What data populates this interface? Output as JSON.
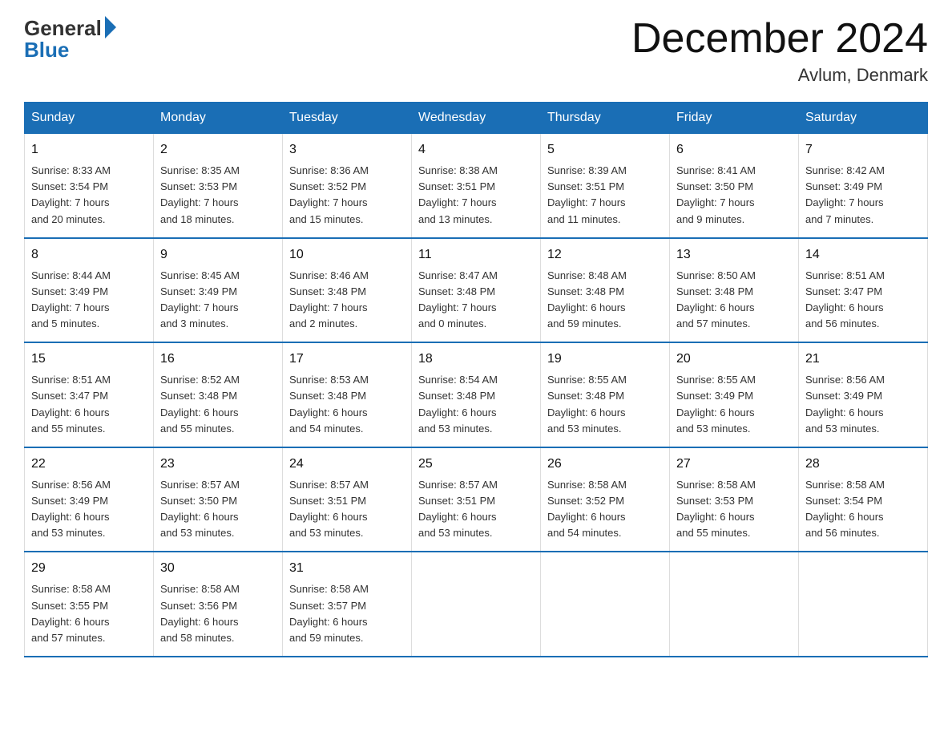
{
  "header": {
    "logo_general": "General",
    "logo_blue": "Blue",
    "month_title": "December 2024",
    "location": "Avlum, Denmark"
  },
  "weekdays": [
    "Sunday",
    "Monday",
    "Tuesday",
    "Wednesday",
    "Thursday",
    "Friday",
    "Saturday"
  ],
  "weeks": [
    [
      {
        "day": "1",
        "sunrise": "Sunrise: 8:33 AM",
        "sunset": "Sunset: 3:54 PM",
        "daylight": "Daylight: 7 hours",
        "daylight2": "and 20 minutes."
      },
      {
        "day": "2",
        "sunrise": "Sunrise: 8:35 AM",
        "sunset": "Sunset: 3:53 PM",
        "daylight": "Daylight: 7 hours",
        "daylight2": "and 18 minutes."
      },
      {
        "day": "3",
        "sunrise": "Sunrise: 8:36 AM",
        "sunset": "Sunset: 3:52 PM",
        "daylight": "Daylight: 7 hours",
        "daylight2": "and 15 minutes."
      },
      {
        "day": "4",
        "sunrise": "Sunrise: 8:38 AM",
        "sunset": "Sunset: 3:51 PM",
        "daylight": "Daylight: 7 hours",
        "daylight2": "and 13 minutes."
      },
      {
        "day": "5",
        "sunrise": "Sunrise: 8:39 AM",
        "sunset": "Sunset: 3:51 PM",
        "daylight": "Daylight: 7 hours",
        "daylight2": "and 11 minutes."
      },
      {
        "day": "6",
        "sunrise": "Sunrise: 8:41 AM",
        "sunset": "Sunset: 3:50 PM",
        "daylight": "Daylight: 7 hours",
        "daylight2": "and 9 minutes."
      },
      {
        "day": "7",
        "sunrise": "Sunrise: 8:42 AM",
        "sunset": "Sunset: 3:49 PM",
        "daylight": "Daylight: 7 hours",
        "daylight2": "and 7 minutes."
      }
    ],
    [
      {
        "day": "8",
        "sunrise": "Sunrise: 8:44 AM",
        "sunset": "Sunset: 3:49 PM",
        "daylight": "Daylight: 7 hours",
        "daylight2": "and 5 minutes."
      },
      {
        "day": "9",
        "sunrise": "Sunrise: 8:45 AM",
        "sunset": "Sunset: 3:49 PM",
        "daylight": "Daylight: 7 hours",
        "daylight2": "and 3 minutes."
      },
      {
        "day": "10",
        "sunrise": "Sunrise: 8:46 AM",
        "sunset": "Sunset: 3:48 PM",
        "daylight": "Daylight: 7 hours",
        "daylight2": "and 2 minutes."
      },
      {
        "day": "11",
        "sunrise": "Sunrise: 8:47 AM",
        "sunset": "Sunset: 3:48 PM",
        "daylight": "Daylight: 7 hours",
        "daylight2": "and 0 minutes."
      },
      {
        "day": "12",
        "sunrise": "Sunrise: 8:48 AM",
        "sunset": "Sunset: 3:48 PM",
        "daylight": "Daylight: 6 hours",
        "daylight2": "and 59 minutes."
      },
      {
        "day": "13",
        "sunrise": "Sunrise: 8:50 AM",
        "sunset": "Sunset: 3:48 PM",
        "daylight": "Daylight: 6 hours",
        "daylight2": "and 57 minutes."
      },
      {
        "day": "14",
        "sunrise": "Sunrise: 8:51 AM",
        "sunset": "Sunset: 3:47 PM",
        "daylight": "Daylight: 6 hours",
        "daylight2": "and 56 minutes."
      }
    ],
    [
      {
        "day": "15",
        "sunrise": "Sunrise: 8:51 AM",
        "sunset": "Sunset: 3:47 PM",
        "daylight": "Daylight: 6 hours",
        "daylight2": "and 55 minutes."
      },
      {
        "day": "16",
        "sunrise": "Sunrise: 8:52 AM",
        "sunset": "Sunset: 3:48 PM",
        "daylight": "Daylight: 6 hours",
        "daylight2": "and 55 minutes."
      },
      {
        "day": "17",
        "sunrise": "Sunrise: 8:53 AM",
        "sunset": "Sunset: 3:48 PM",
        "daylight": "Daylight: 6 hours",
        "daylight2": "and 54 minutes."
      },
      {
        "day": "18",
        "sunrise": "Sunrise: 8:54 AM",
        "sunset": "Sunset: 3:48 PM",
        "daylight": "Daylight: 6 hours",
        "daylight2": "and 53 minutes."
      },
      {
        "day": "19",
        "sunrise": "Sunrise: 8:55 AM",
        "sunset": "Sunset: 3:48 PM",
        "daylight": "Daylight: 6 hours",
        "daylight2": "and 53 minutes."
      },
      {
        "day": "20",
        "sunrise": "Sunrise: 8:55 AM",
        "sunset": "Sunset: 3:49 PM",
        "daylight": "Daylight: 6 hours",
        "daylight2": "and 53 minutes."
      },
      {
        "day": "21",
        "sunrise": "Sunrise: 8:56 AM",
        "sunset": "Sunset: 3:49 PM",
        "daylight": "Daylight: 6 hours",
        "daylight2": "and 53 minutes."
      }
    ],
    [
      {
        "day": "22",
        "sunrise": "Sunrise: 8:56 AM",
        "sunset": "Sunset: 3:49 PM",
        "daylight": "Daylight: 6 hours",
        "daylight2": "and 53 minutes."
      },
      {
        "day": "23",
        "sunrise": "Sunrise: 8:57 AM",
        "sunset": "Sunset: 3:50 PM",
        "daylight": "Daylight: 6 hours",
        "daylight2": "and 53 minutes."
      },
      {
        "day": "24",
        "sunrise": "Sunrise: 8:57 AM",
        "sunset": "Sunset: 3:51 PM",
        "daylight": "Daylight: 6 hours",
        "daylight2": "and 53 minutes."
      },
      {
        "day": "25",
        "sunrise": "Sunrise: 8:57 AM",
        "sunset": "Sunset: 3:51 PM",
        "daylight": "Daylight: 6 hours",
        "daylight2": "and 53 minutes."
      },
      {
        "day": "26",
        "sunrise": "Sunrise: 8:58 AM",
        "sunset": "Sunset: 3:52 PM",
        "daylight": "Daylight: 6 hours",
        "daylight2": "and 54 minutes."
      },
      {
        "day": "27",
        "sunrise": "Sunrise: 8:58 AM",
        "sunset": "Sunset: 3:53 PM",
        "daylight": "Daylight: 6 hours",
        "daylight2": "and 55 minutes."
      },
      {
        "day": "28",
        "sunrise": "Sunrise: 8:58 AM",
        "sunset": "Sunset: 3:54 PM",
        "daylight": "Daylight: 6 hours",
        "daylight2": "and 56 minutes."
      }
    ],
    [
      {
        "day": "29",
        "sunrise": "Sunrise: 8:58 AM",
        "sunset": "Sunset: 3:55 PM",
        "daylight": "Daylight: 6 hours",
        "daylight2": "and 57 minutes."
      },
      {
        "day": "30",
        "sunrise": "Sunrise: 8:58 AM",
        "sunset": "Sunset: 3:56 PM",
        "daylight": "Daylight: 6 hours",
        "daylight2": "and 58 minutes."
      },
      {
        "day": "31",
        "sunrise": "Sunrise: 8:58 AM",
        "sunset": "Sunset: 3:57 PM",
        "daylight": "Daylight: 6 hours",
        "daylight2": "and 59 minutes."
      },
      {
        "day": "",
        "sunrise": "",
        "sunset": "",
        "daylight": "",
        "daylight2": ""
      },
      {
        "day": "",
        "sunrise": "",
        "sunset": "",
        "daylight": "",
        "daylight2": ""
      },
      {
        "day": "",
        "sunrise": "",
        "sunset": "",
        "daylight": "",
        "daylight2": ""
      },
      {
        "day": "",
        "sunrise": "",
        "sunset": "",
        "daylight": "",
        "daylight2": ""
      }
    ]
  ]
}
